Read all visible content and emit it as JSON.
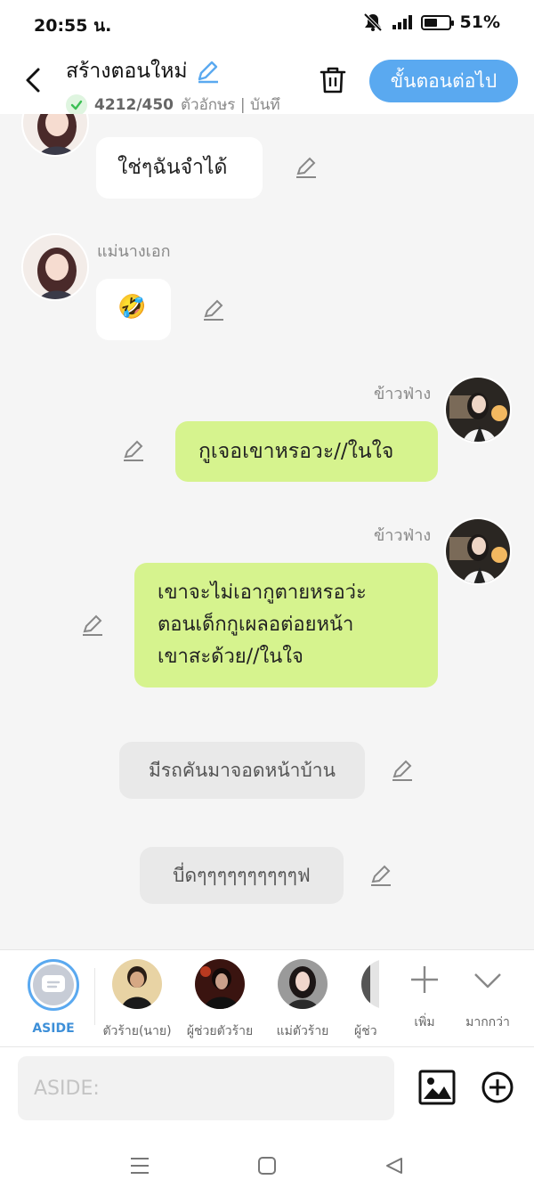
{
  "status_bar": {
    "time": "20:55 น.",
    "battery": "51%"
  },
  "header": {
    "title": "สร้างตอนใหม่",
    "char_count": "4212/450",
    "char_unit": "ตัวอักษร | บันทึ",
    "next_button": "ขั้นตอนต่อไป"
  },
  "messages": [
    {
      "sender": "",
      "text": "ใช่ๆฉันจำได้"
    },
    {
      "sender": "แม่นางเอก",
      "text": "🤣"
    },
    {
      "sender": "ข้าวฟ่าง",
      "text": "กูเจอเขาหรอวะ//ในใจ"
    },
    {
      "sender": "ข้าวฟ่าง",
      "lines": [
        "เขาจะไม่เอากูตายหรอว่ะ",
        "ตอนเด็กกูเผลอต่อยหน้า",
        "เขาสะด้วย//ในใจ"
      ]
    },
    {
      "text": "มีรถคันมาจอดหน้าบ้าน"
    },
    {
      "text": "บี่ดๆๆๆๆๆๆๆๆๆๆฟ"
    }
  ],
  "characters": [
    {
      "label": "ASIDE"
    },
    {
      "label": "ตัวร้าย(นาย)"
    },
    {
      "label": "ผู้ช่วยตัวร้าย"
    },
    {
      "label": "แม่ตัวร้าย"
    },
    {
      "label": "ผู้ช่ว"
    },
    {
      "label": "เพิ่ม"
    },
    {
      "label": "มากกว่า"
    }
  ],
  "input": {
    "placeholder": "ASIDE:"
  },
  "colors": {
    "accent": "#5aa9f0",
    "green_bubble": "#d6f38e",
    "background": "#f5f5f5"
  }
}
